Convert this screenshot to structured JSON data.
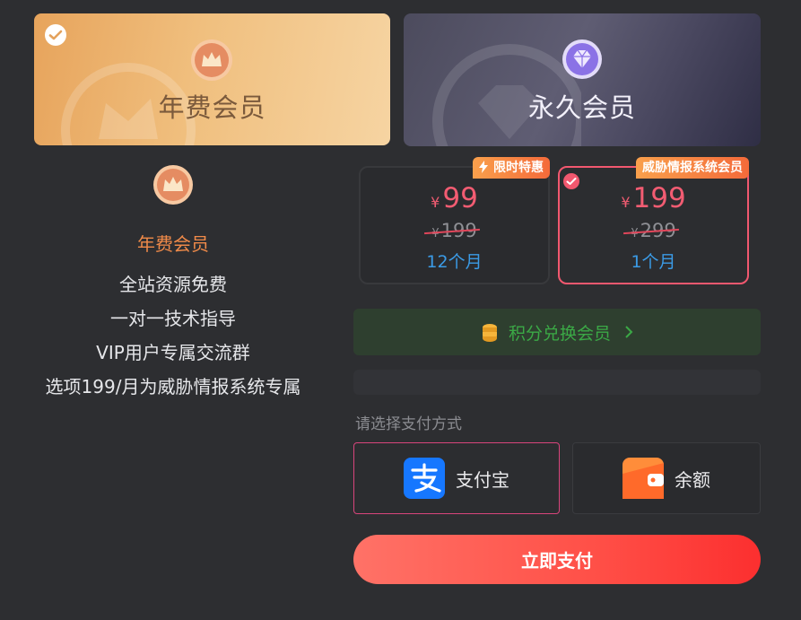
{
  "cards": [
    {
      "title": "年费会员",
      "selected": true
    },
    {
      "title": "永久会员",
      "selected": false
    }
  ],
  "features": {
    "title": "年费会员",
    "items": [
      "全站资源免费",
      "一对一技术指导",
      "VIP用户专属交流群",
      "选项199/月为威胁情报系统专属"
    ]
  },
  "plans": [
    {
      "badge": "限时特惠",
      "currency": "¥",
      "price": "99",
      "original_price": "199",
      "duration": "12个月",
      "selected": false
    },
    {
      "badge": "威胁情报系统会员",
      "currency": "¥",
      "price": "199",
      "original_price": "299",
      "duration": "1个月",
      "selected": true
    }
  ],
  "points_exchange": {
    "label": "积分兑换会员"
  },
  "payment": {
    "label": "请选择支付方式",
    "methods": [
      {
        "label": "支付宝",
        "icon": "alipay-icon",
        "selected": true
      },
      {
        "label": "余额",
        "icon": "wallet-icon",
        "selected": false
      }
    ],
    "submit_label": "立即支付"
  },
  "colors": {
    "accent": "#f2586f",
    "price": "#f25c72",
    "duration": "#3b9be6",
    "points": "#3ba946",
    "feature_title": "#ef8a49",
    "pay_button": "#ff4f47"
  }
}
